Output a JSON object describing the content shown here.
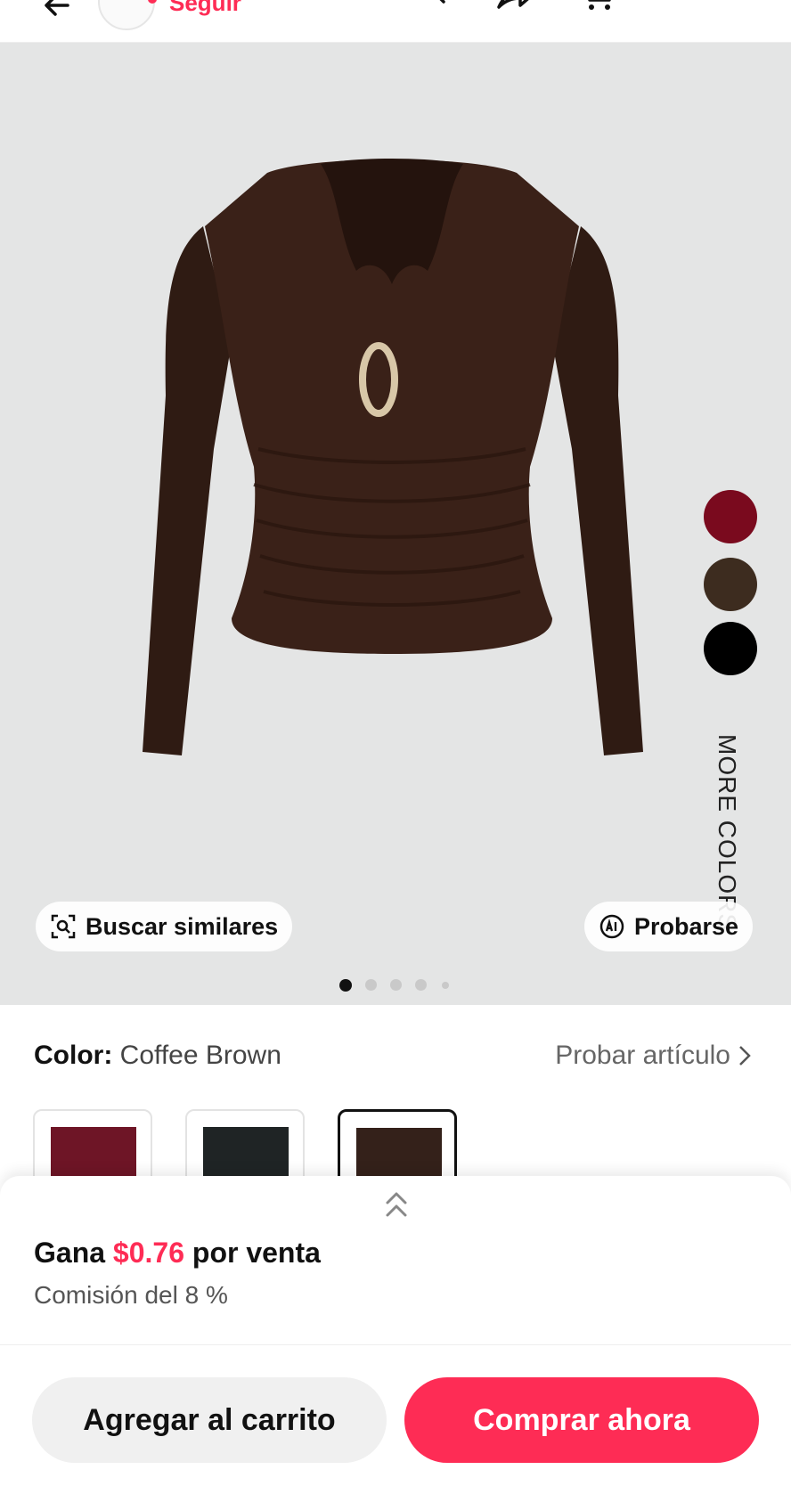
{
  "header": {
    "follow_label": "Seguir"
  },
  "gallery": {
    "more_colors_label": "MORE COLORS",
    "search_similar_label": "Buscar similares",
    "try_on_label": "Probarse",
    "image_index": 1,
    "image_count": 5,
    "color_dots": [
      "#7a0a1e",
      "#3d2c1f",
      "#000000"
    ],
    "product_color": "#3a2118"
  },
  "color": {
    "label": "Color:",
    "value": "Coffee Brown",
    "try_item_label": "Probar artículo",
    "variants": [
      {
        "swatch": "#6e1526",
        "selected": false
      },
      {
        "swatch": "#1f2425",
        "selected": false
      },
      {
        "swatch": "#34211a",
        "selected": true
      }
    ]
  },
  "earnings": {
    "prefix": "Gana",
    "amount": "$0.76",
    "suffix": "por venta",
    "commission": "Comisión del 8 %"
  },
  "actions": {
    "add_to_cart": "Agregar al carrito",
    "buy_now": "Comprar ahora"
  },
  "colors": {
    "accent": "#fe2c55"
  }
}
